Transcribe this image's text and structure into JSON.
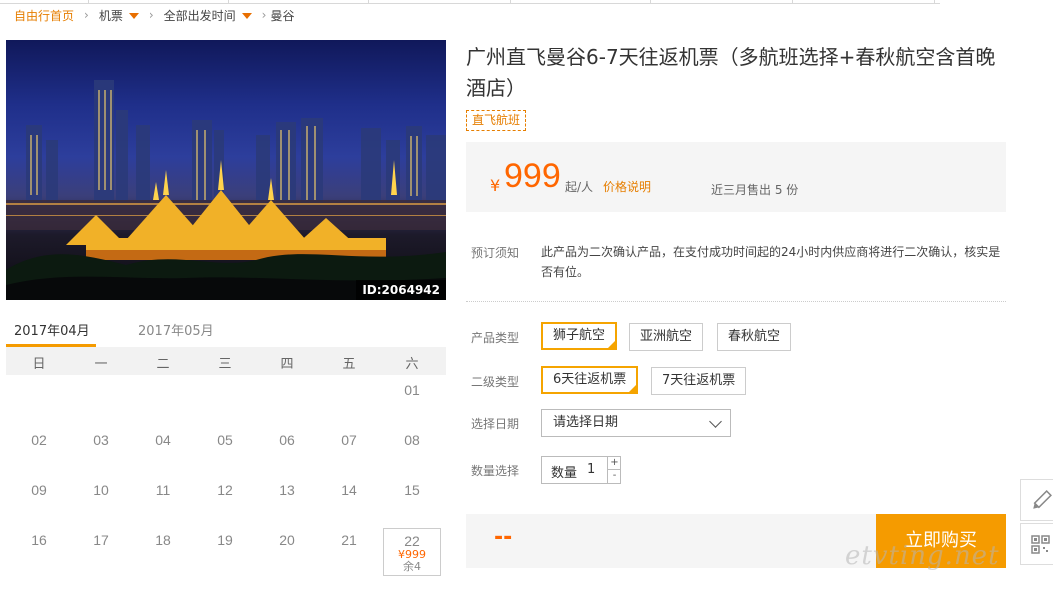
{
  "breadcrumb": {
    "home": "自由行首页",
    "item1": "机票",
    "item2": "全部出发时间",
    "item3": "曼谷"
  },
  "hero": {
    "id_label": "ID:2064942"
  },
  "product": {
    "title": "广州直飞曼谷6-7天往返机票（多航班选择+春秋航空含首晚酒店）",
    "tag": "直飞航班",
    "currency": "¥",
    "price": "999",
    "price_unit": "起/人",
    "price_note": "价格说明",
    "sold": "近三月售出 5 份"
  },
  "notice": {
    "label": "预订须知",
    "text": "此产品为二次确认产品，在支付成功时间起的24小时内供应商将进行二次确认，核实是否有位。"
  },
  "options": {
    "product_type_label": "产品类型",
    "product_types": [
      "狮子航空",
      "亚洲航空",
      "春秋航空"
    ],
    "product_type_selected": "狮子航空",
    "sub_type_label": "二级类型",
    "sub_types": [
      "6天往返机票",
      "7天往返机票"
    ],
    "sub_type_selected": "6天往返机票",
    "date_label": "选择日期",
    "date_placeholder": "请选择日期",
    "quantity_label": "数量选择",
    "quantity_field_label": "数量",
    "quantity_value": "1",
    "plus": "+",
    "minus": "-"
  },
  "buy": {
    "total": "--",
    "button": "立即购买"
  },
  "calendar": {
    "tabs": [
      "2017年04月",
      "2017年05月"
    ],
    "active_tab": "2017年04月",
    "weekdays": [
      "日",
      "一",
      "二",
      "三",
      "四",
      "五",
      "六"
    ],
    "rows": [
      [
        "",
        "",
        "",
        "",
        "",
        "",
        "01"
      ],
      [
        "02",
        "03",
        "04",
        "05",
        "06",
        "07",
        "08"
      ],
      [
        "09",
        "10",
        "11",
        "12",
        "13",
        "14",
        "15"
      ],
      [
        "16",
        "17",
        "18",
        "19",
        "20",
        "21",
        "22"
      ]
    ],
    "highlight_day": "22",
    "highlight_price": "¥999",
    "highlight_left": "余4"
  },
  "watermark": "etvting.net",
  "icons": [
    "caret-down-icon",
    "chevron-right-icon",
    "chevron-down-icon",
    "edit-icon",
    "qr-code-icon"
  ]
}
